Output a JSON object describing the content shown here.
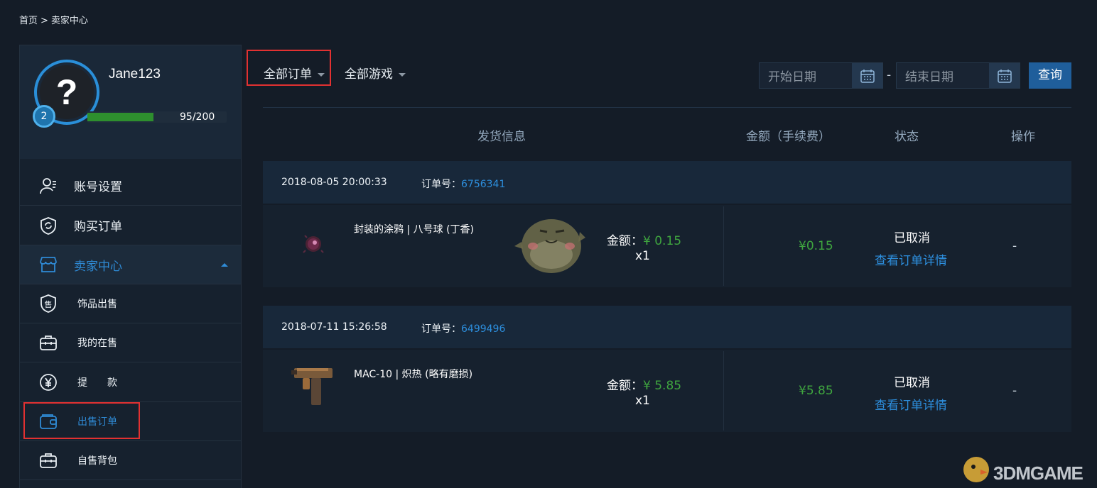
{
  "breadcrumb": {
    "home": "首页",
    "sep": ">",
    "current": "卖家中心"
  },
  "profile": {
    "username": "Jane123",
    "avatar_glyph": "?",
    "level": "2",
    "xp_current": "95",
    "xp_total": "/200",
    "xp_fraction": 0.475
  },
  "sidebar": {
    "items": [
      {
        "label": "账号设置",
        "icon": "user-settings-icon"
      },
      {
        "label": "购买订单",
        "icon": "shield-refresh-icon"
      },
      {
        "label": "卖家中心",
        "icon": "store-icon"
      }
    ],
    "sub_items": [
      {
        "label": "饰品出售",
        "icon": "sell-badge-icon"
      },
      {
        "label": "我的在售",
        "icon": "briefcase-icon"
      },
      {
        "label": "提　　款",
        "icon": "yen-circle-icon"
      },
      {
        "label": "出售订单",
        "icon": "wallet-icon"
      },
      {
        "label": "自售背包",
        "icon": "backpack-icon"
      }
    ]
  },
  "filters": {
    "all_orders": "全部订单",
    "all_games": "全部游戏"
  },
  "dates": {
    "start_placeholder": "开始日期",
    "end_placeholder": "结束日期",
    "separator": "-"
  },
  "query_button": "查询",
  "table_headers": {
    "shipping": "发货信息",
    "amount": "金额（手续费）",
    "status": "状态",
    "action": "操作"
  },
  "orders": [
    {
      "time": "2018-08-05 20:00:33",
      "order_no_label": "订单号：",
      "order_no": "6756341",
      "item_name": "封装的涂鸦 | 八号球 (丁香)",
      "amount_label": "金额：",
      "amount": "¥ 0.15",
      "qty": "x1",
      "price": "¥0.15",
      "status": "已取消",
      "detail_link": "查看订单详情",
      "action": "-"
    },
    {
      "time": "2018-07-11 15:26:58",
      "order_no_label": "订单号：",
      "order_no": "6499496",
      "item_name": "MAC-10 | 炽热 (略有磨损)",
      "amount_label": "金额：",
      "amount": "¥ 5.85",
      "qty": "x1",
      "price": "¥5.85",
      "status": "已取消",
      "detail_link": "查看订单详情",
      "action": "-"
    }
  ],
  "watermark": "3DMGAME",
  "colors": {
    "accent": "#2d8fde",
    "price_green": "#3fa53f",
    "highlight_red": "#e23131",
    "bg": "#141c27"
  }
}
